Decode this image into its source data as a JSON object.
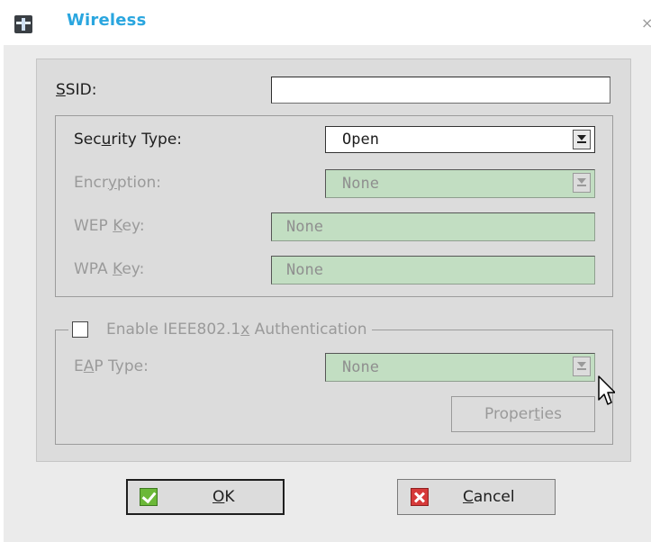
{
  "window": {
    "title": "Wireless",
    "close_glyph": "×",
    "icon": "network-icon"
  },
  "ssid": {
    "label_mnemonic": "S",
    "label_rest": "SID:",
    "value": ""
  },
  "security": {
    "type_label_pre": "Sec",
    "type_label_mnemonic": "u",
    "type_label_post": "rity Type:",
    "type_value": "Open",
    "encryption_label_pre": "Encr",
    "encryption_label_mnemonic": "y",
    "encryption_label_post": "ption:",
    "encryption_value": "None",
    "wep_label_pre": "WEP ",
    "wep_label_mnemonic": "K",
    "wep_label_post": "ey:",
    "wep_value": "None",
    "wpa_label_pre": "WPA ",
    "wpa_label_mnemonic": "K",
    "wpa_label_post": "ey:",
    "wpa_value": "None"
  },
  "eap": {
    "enable_label_pre": "Enable IEEE802.1",
    "enable_label_mnemonic": "x",
    "enable_label_post": " Authentication",
    "enabled": false,
    "type_label_pre": "E",
    "type_label_mnemonic": "A",
    "type_label_post": "P Type:",
    "type_value": "None",
    "properties_pre": "Proper",
    "properties_mnemonic": "t",
    "properties_post": "ies"
  },
  "buttons": {
    "ok_mnemonic": "O",
    "ok_rest": "K",
    "ok_icon": "check-icon",
    "cancel_mnemonic": "C",
    "cancel_rest": "ancel",
    "cancel_icon": "x-icon"
  },
  "colors": {
    "title": "#2aa6df",
    "disabled_field": "#c2dec2",
    "panel": "#dcdcdc"
  }
}
